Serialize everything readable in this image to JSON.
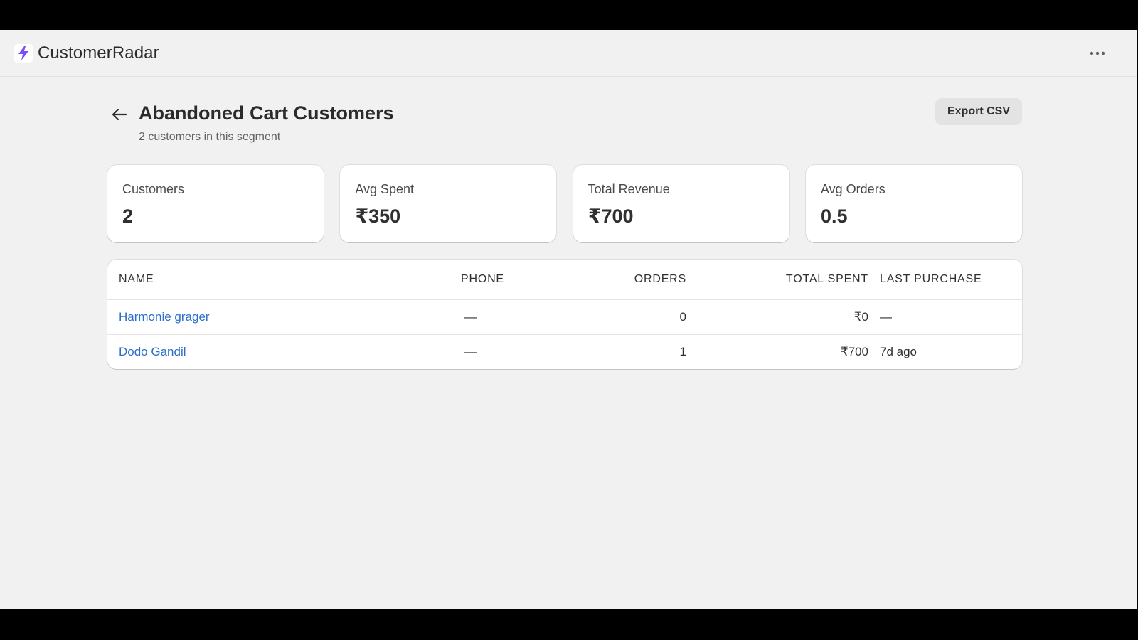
{
  "app": {
    "title": "CustomerRadar",
    "logo_icon": "lightning-bolt-icon",
    "brand_color": "#7b4ff5"
  },
  "header": {
    "title": "Abandoned Cart Customers",
    "subtitle": "2 customers in this segment",
    "export_label": "Export CSV"
  },
  "stats": [
    {
      "label": "Customers",
      "value": "2"
    },
    {
      "label": "Avg Spent",
      "value": "₹350"
    },
    {
      "label": "Total Revenue",
      "value": "₹700"
    },
    {
      "label": "Avg Orders",
      "value": "0.5"
    }
  ],
  "table": {
    "columns": {
      "name": "NAME",
      "phone": "PHONE",
      "orders": "ORDERS",
      "total_spent": "TOTAL SPENT",
      "last_purchase": "LAST PURCHASE"
    },
    "rows": [
      {
        "name": "Harmonie grager",
        "phone": "—",
        "orders": "0",
        "total_spent": "₹0",
        "last_purchase": "—"
      },
      {
        "name": "Dodo Gandil",
        "phone": "—",
        "orders": "1",
        "total_spent": "₹700",
        "last_purchase": "7d ago"
      }
    ]
  },
  "colors": {
    "link": "#2c6ecb",
    "background": "#f1f1f1",
    "card": "#ffffff"
  }
}
